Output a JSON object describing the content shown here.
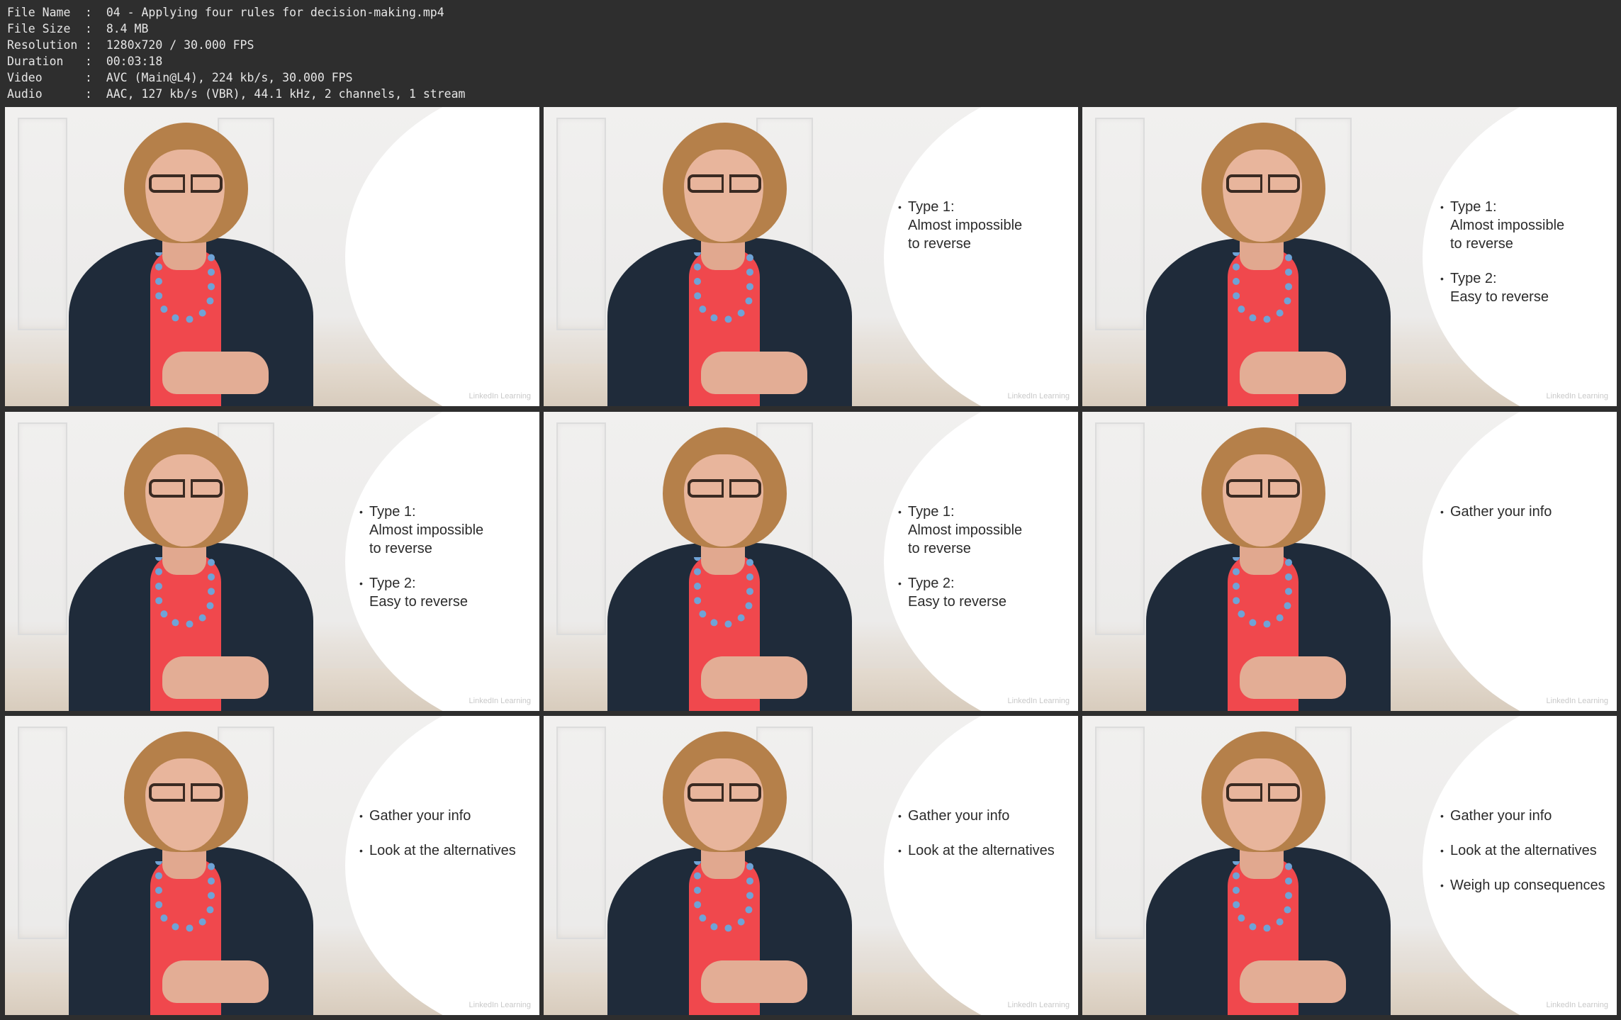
{
  "meta": [
    {
      "key": "File Name",
      "value": "04 - Applying four rules for decision-making.mp4"
    },
    {
      "key": "File Size",
      "value": "8.4 MB"
    },
    {
      "key": "Resolution",
      "value": "1280x720 / 30.000 FPS"
    },
    {
      "key": "Duration",
      "value": "00:03:18"
    },
    {
      "key": "Video",
      "value": "AVC (Main@L4), 224 kb/s, 30.000 FPS"
    },
    {
      "key": "Audio",
      "value": "AAC, 127 kb/s (VBR), 44.1 kHz, 2 channels, 1 stream"
    }
  ],
  "watermark": "LinkedIn Learning",
  "frames": [
    {
      "bullets": []
    },
    {
      "bullets": [
        "Type 1:\nAlmost impossible\nto reverse"
      ]
    },
    {
      "bullets": [
        "Type 1:\nAlmost impossible\nto reverse",
        "Type 2:\nEasy to reverse"
      ]
    },
    {
      "bullets": [
        "Type 1:\nAlmost impossible\nto reverse",
        "Type 2:\nEasy to reverse"
      ]
    },
    {
      "bullets": [
        "Type 1:\nAlmost impossible\nto reverse",
        "Type 2:\nEasy to reverse"
      ]
    },
    {
      "bullets": [
        "Gather your info"
      ]
    },
    {
      "bullets": [
        "Gather your info",
        "Look at the alternatives"
      ]
    },
    {
      "bullets": [
        "Gather your info",
        "Look at the alternatives"
      ]
    },
    {
      "bullets": [
        "Gather your info",
        "Look at the alternatives",
        "Weigh up consequences"
      ]
    }
  ]
}
